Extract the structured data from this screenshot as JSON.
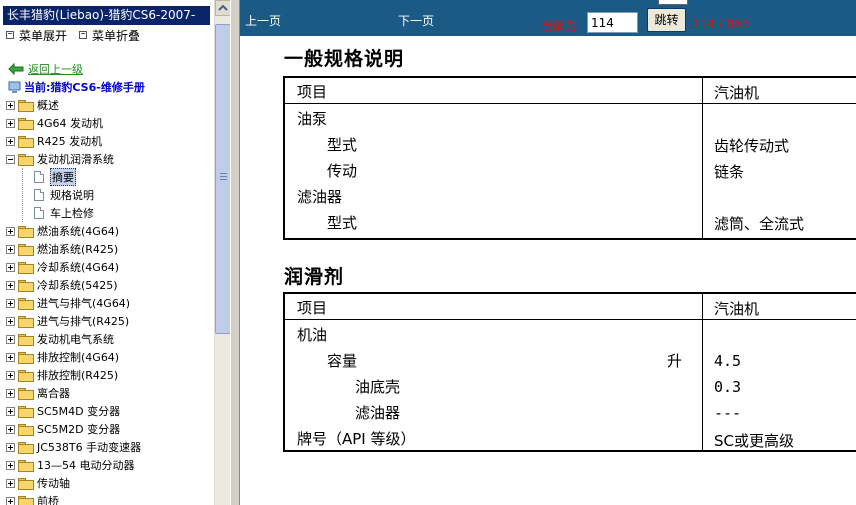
{
  "sidebar": {
    "title": "长丰猎豹(Liebao)-猎豹CS6-2007-",
    "expand_label": "菜单展开",
    "collapse_label": "菜单折叠",
    "back_label": "返回上一级",
    "current_label": "当前:猎豹CS6-维修手册",
    "tree": [
      {
        "label": "概述",
        "expanded": false
      },
      {
        "label": "4G64 发动机",
        "expanded": false
      },
      {
        "label": "R425 发动机",
        "expanded": false
      },
      {
        "label": "发动机润滑系统",
        "expanded": true
      },
      {
        "label": "燃油系统(4G64)",
        "expanded": false
      },
      {
        "label": "燃油系统(R425)",
        "expanded": false
      },
      {
        "label": "冷却系统(4G64)",
        "expanded": false
      },
      {
        "label": "冷却系统(5425)",
        "expanded": false
      },
      {
        "label": "进气与排气(4G64)",
        "expanded": false
      },
      {
        "label": "进气与排气(R425)",
        "expanded": false
      },
      {
        "label": "发动机电气系统",
        "expanded": false
      },
      {
        "label": "排放控制(4G64)",
        "expanded": false
      },
      {
        "label": "排放控制(R425)",
        "expanded": false
      },
      {
        "label": "离合器",
        "expanded": false
      },
      {
        "label": "SC5M4D 变分器",
        "expanded": false
      },
      {
        "label": "SC5M2D 变分器",
        "expanded": false
      },
      {
        "label": "JC538T6 手动变速器",
        "expanded": false
      },
      {
        "label": "13—54 电动分动器",
        "expanded": false
      },
      {
        "label": "传动轴",
        "expanded": false
      },
      {
        "label": "前桥",
        "expanded": false
      }
    ],
    "children": [
      "摘要",
      "规格说明",
      "车上检修"
    ],
    "selected_child": "摘要"
  },
  "toolbar": {
    "prev_label": "上一页",
    "next_label": "下一页",
    "current_page_label": "当前为",
    "page_input_value": "114",
    "go_label": "跳转",
    "page_status": "114 / 863"
  },
  "document": {
    "section1": {
      "title": "一般规格说明",
      "header_item": "项目",
      "header_value": "汽油机",
      "rows": [
        {
          "item": "油泵",
          "indent": 0,
          "value": ""
        },
        {
          "item": "型式",
          "indent": 1,
          "value": "齿轮传动式"
        },
        {
          "item": "传动",
          "indent": 1,
          "value": "链条"
        },
        {
          "item": "滤油器",
          "indent": 0,
          "value": ""
        },
        {
          "item": "型式",
          "indent": 1,
          "value": "滤筒、全流式"
        }
      ]
    },
    "section2": {
      "title": "润滑剂",
      "header_item": "项目",
      "header_value": "汽油机",
      "unit": "升",
      "rows": [
        {
          "item": "机油",
          "indent": 0,
          "value": ""
        },
        {
          "item": "容量",
          "indent": 1,
          "value": "4.5"
        },
        {
          "item": "油底壳",
          "indent": 2,
          "value": "0.3"
        },
        {
          "item": "滤油器",
          "indent": 2,
          "value": "---"
        },
        {
          "item": "牌号（API 等级）",
          "indent": 0,
          "value": "SC或更高级"
        }
      ]
    }
  },
  "colors": {
    "toolbar_bg": "#1c5a86",
    "title_bar_bg": "#0a246a",
    "page_status": "#d01818",
    "back_link": "#228b22",
    "current_label": "#0000cc"
  }
}
